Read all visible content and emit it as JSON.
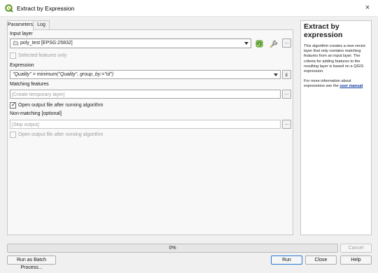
{
  "window": {
    "title": "Extract by Expression",
    "close_glyph": "×"
  },
  "tabs": [
    {
      "label": "Parameters",
      "active": true
    },
    {
      "label": "Log",
      "active": false
    }
  ],
  "params": {
    "input_layer_label": "Input layer",
    "input_layer_value": "poly_test [EPSG:25832]",
    "selected_only_label": "Selected features only",
    "selected_only_checked": false,
    "expression_label": "Expression",
    "expression_value": "\"Quality\" = minimum(\"Quality\", group_by:=\"id\")",
    "matching_label": "Matching features",
    "matching_placeholder": "[Create temporary layer]",
    "open_after_label": "Open output file after running algorithm",
    "open_after_checked": true,
    "nonmatching_label": "Non-matching [optional]",
    "nonmatching_placeholder": "[Skip output]",
    "open_after2_label": "Open output file after running algorithm",
    "open_after2_checked": false,
    "dots": "...",
    "epsilon": "ε"
  },
  "help": {
    "title": "Extract by expression",
    "body": "This algorithm creates a new vector layer that only contains matching features from an input layer. The criteria for adding features to the resulting layer is based on a QGIS expression.",
    "more_prefix": "For more information about expressions see the",
    "link": "user manual"
  },
  "progress": {
    "text": "0%",
    "value": 0
  },
  "buttons": {
    "cancel": "Cancel",
    "batch": "Run as Batch Process...",
    "run": "Run",
    "close": "Close",
    "help": "Help"
  },
  "colors": {
    "accent": "#2a7bd0",
    "link": "#0b3a9e",
    "qgis_green": "#589632"
  },
  "icons": [
    "qgis-logo-icon",
    "close-icon",
    "polygon-layer-icon",
    "chevron-down-icon",
    "iterate-icon",
    "wrench-icon",
    "expression-icon",
    "checkmark-icon"
  ]
}
